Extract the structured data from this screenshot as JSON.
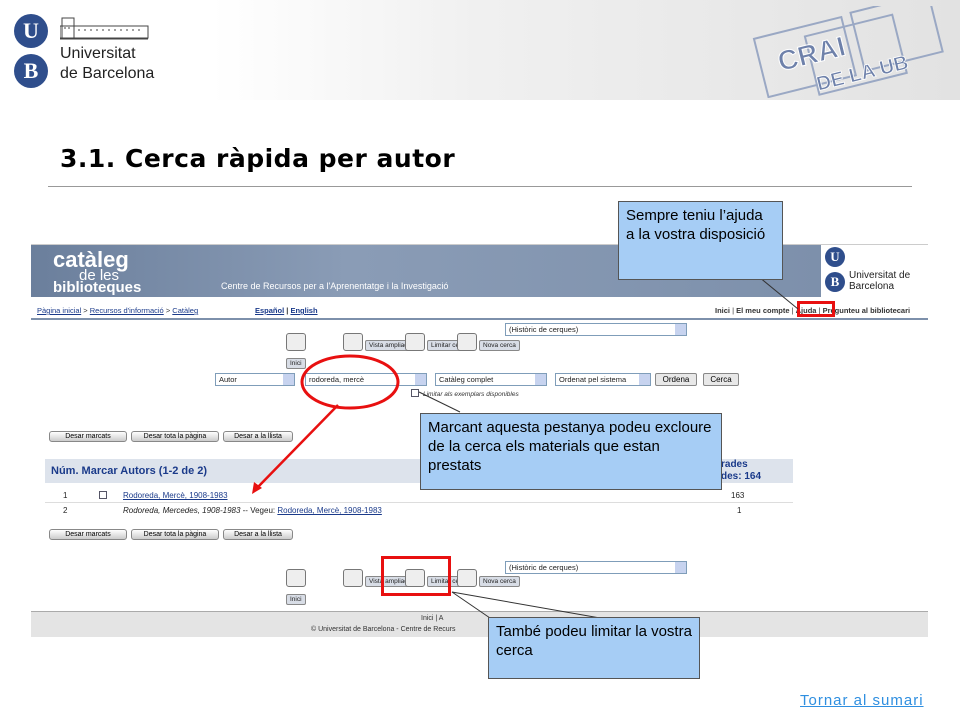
{
  "header": {
    "university_line1": "Universitat",
    "university_line2": "de Barcelona",
    "seal_u": "U",
    "seal_b": "B",
    "crai_logo_text": [
      "CRAI",
      "DE LA UB"
    ]
  },
  "title": "3.1. Cerca ràpida per autor",
  "catalog": {
    "banner_line1": "catàleg",
    "banner_line2": "de les",
    "banner_line3": "biblioteques",
    "banner_subtitle": "Centre de Recursos per a l'Aprenentatge i la Investigació",
    "logo_name": "Universitat de Barcelona",
    "breadcrumb": [
      "Pàgina inicial",
      "Recursos d'informació",
      "Catàleg"
    ],
    "languages": [
      "Español",
      "English"
    ],
    "top_links": [
      "Inici",
      "El meu compte",
      "Ajuda",
      "Pregunteu al bibliotecari"
    ],
    "toolbar": [
      "Inici",
      "Vista ampliada",
      "Limitar cerca",
      "Nova cerca"
    ],
    "history_select": "(Històric de cerques)",
    "search": {
      "field": "Autor",
      "query": "rodoreda, mercè",
      "scope": "Catàleg complet",
      "sort": "Ordenat pel sistema",
      "sort_button": "Ordena",
      "search_button": "Cerca",
      "limit_label": "Limitar als exemplars disponibles"
    },
    "mark_buttons": [
      "Desar marcats",
      "Desar tota la pàgina",
      "Desar a la llista"
    ],
    "results": {
      "header": "Núm. Marcar Autors (1-2 de 2)",
      "right_header": "rades",
      "right_header2": "des: 164",
      "rows": [
        {
          "num": "1",
          "text_link": "Rodoreda, Mercè, 1908-1983",
          "count": "163"
        },
        {
          "num": "2",
          "text_italic": "Rodoreda, Mercedes, 1908-1983",
          "see": " -- Vegeu: ",
          "text_link": "Rodoreda, Mercè, 1908-1983",
          "count": "1"
        }
      ]
    },
    "footer_links": "Inici | A",
    "footer_copy": "© Universitat de Barcelona - Centre de Recurs"
  },
  "callouts": {
    "help": "Sempre teniu l’ajuda a la vostra disposició",
    "limit_checkbox": "Marcant aquesta pestanya podeu excloure de la cerca els materials que estan prestats",
    "limit_search": "També podeu limitar la vostra cerca"
  },
  "back_link": "Tornar al sumari"
}
